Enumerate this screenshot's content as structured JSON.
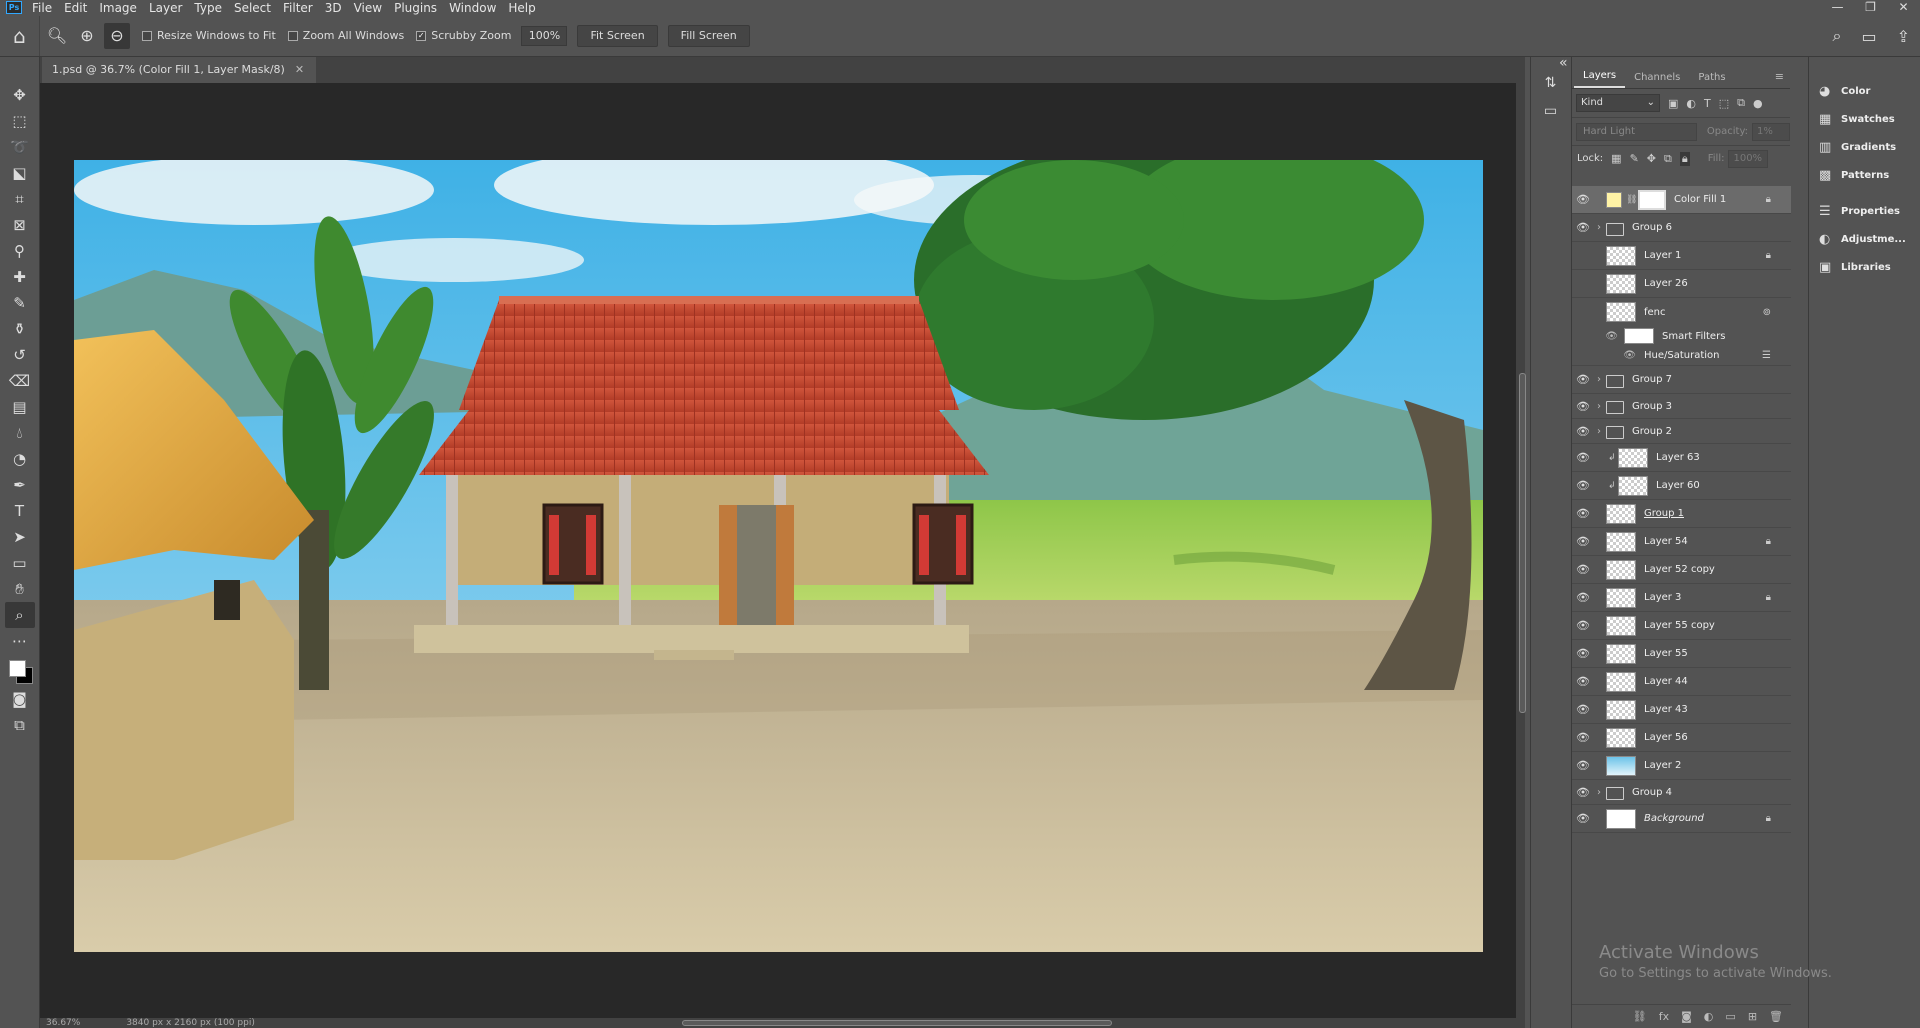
{
  "app": {
    "logo": "Ps"
  },
  "menu": [
    "File",
    "Edit",
    "Image",
    "Layer",
    "Type",
    "Select",
    "Filter",
    "3D",
    "View",
    "Plugins",
    "Window",
    "Help"
  ],
  "window_controls": {
    "minimize": "—",
    "restore": "❐",
    "close": "✕"
  },
  "options": {
    "resize_windows": "Resize Windows to Fit",
    "zoom_all": "Zoom All Windows",
    "scrubby": "Scrubby Zoom",
    "zoom_value": "100%",
    "fit_screen": "Fit Screen",
    "fill_screen": "Fill Screen"
  },
  "document": {
    "tab_title": "1.psd @ 36.7% (Color Fill 1, Layer Mask/8)",
    "status_zoom": "36.67%",
    "status_size": "3840 px x 2160 px (100 ppi)"
  },
  "layers_panel": {
    "tabs": [
      "Layers",
      "Channels",
      "Paths"
    ],
    "filter_kind": "Kind",
    "blend_mode": "Hard Light",
    "opacity_label": "Opacity:",
    "opacity_value": "1%",
    "lock_label": "Lock:",
    "fill_label": "Fill:",
    "fill_value": "100%",
    "layers": [
      {
        "name": "Color Fill 1"
      },
      {
        "name": "Group 6"
      },
      {
        "name": "Layer 1"
      },
      {
        "name": "Layer 26"
      },
      {
        "name": "fenc"
      },
      {
        "name": "Smart Filters"
      },
      {
        "name": "Hue/Saturation"
      },
      {
        "name": "Group 7"
      },
      {
        "name": "Group 3"
      },
      {
        "name": "Group 2"
      },
      {
        "name": "Layer 63"
      },
      {
        "name": "Layer 60"
      },
      {
        "name": "Group 1"
      },
      {
        "name": "Layer 54"
      },
      {
        "name": "Layer 52 copy"
      },
      {
        "name": "Layer 3"
      },
      {
        "name": "Layer 55 copy"
      },
      {
        "name": "Layer 55"
      },
      {
        "name": "Layer 44"
      },
      {
        "name": "Layer 43"
      },
      {
        "name": "Layer 56"
      },
      {
        "name": "Layer 2"
      },
      {
        "name": "Group 4"
      },
      {
        "name": "Background"
      }
    ]
  },
  "right_dock": [
    "Color",
    "Swatches",
    "Gradients",
    "Patterns",
    "Properties",
    "Adjustme...",
    "Libraries"
  ],
  "activate_windows": {
    "line1": "Activate Windows",
    "line2": "Go to Settings to activate Windows."
  },
  "colors": {
    "panel": "#535353",
    "canvas_bg": "#282828",
    "selected_layer": "#6b6b6b",
    "sky": "#5ec0ea",
    "roof": "#c9482f",
    "wall": "#c9b07a",
    "ground": "#cfc09a"
  }
}
